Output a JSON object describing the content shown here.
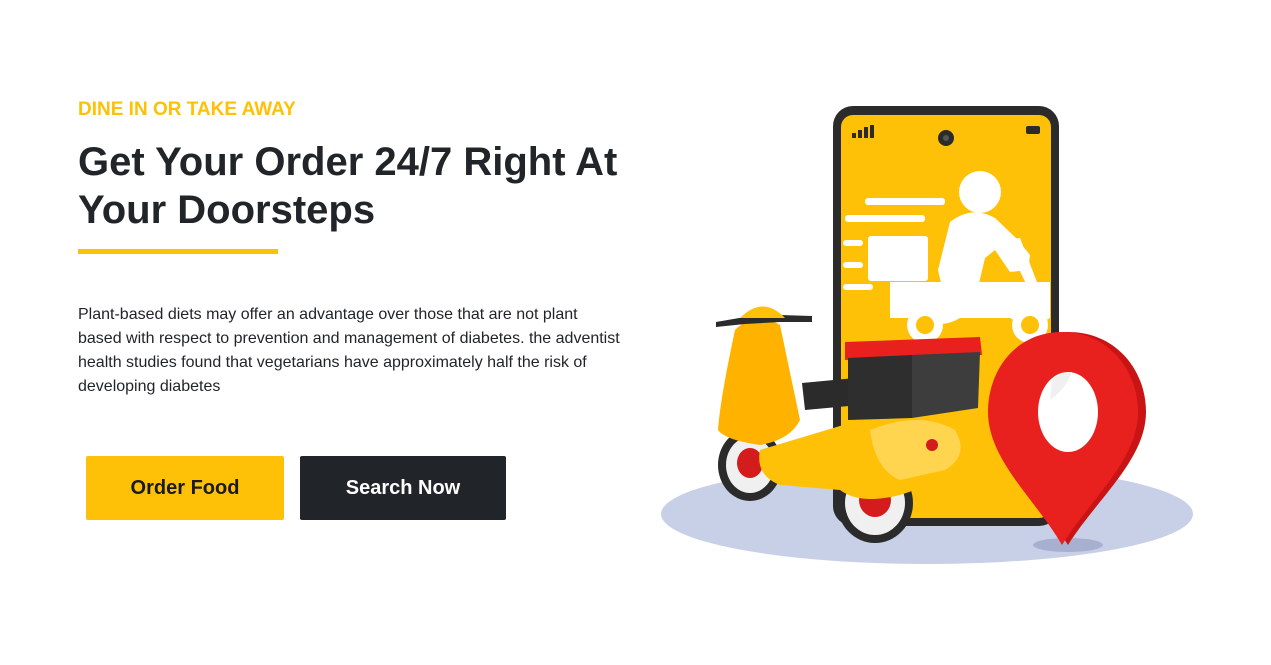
{
  "hero": {
    "eyebrow": "DINE IN OR TAKE AWAY",
    "title": "Get Your Order 24/7 Right At Your Doorsteps",
    "description": "Plant-based diets may offer an advantage over those that are not plant based with respect to prevention and management of diabetes. the adventist health studies found that vegetarians have approximately half the risk of developing diabetes",
    "buttons": {
      "order_label": "Order Food",
      "search_label": "Search Now"
    }
  },
  "colors": {
    "accent": "#ffc107",
    "dark": "#212529",
    "pin_red": "#e8201e",
    "shadow_blue": "#c8d0e8"
  },
  "illustration": {
    "icons": [
      "phone-icon",
      "delivery-rider-icon",
      "scooter-icon",
      "location-pin-icon"
    ]
  }
}
